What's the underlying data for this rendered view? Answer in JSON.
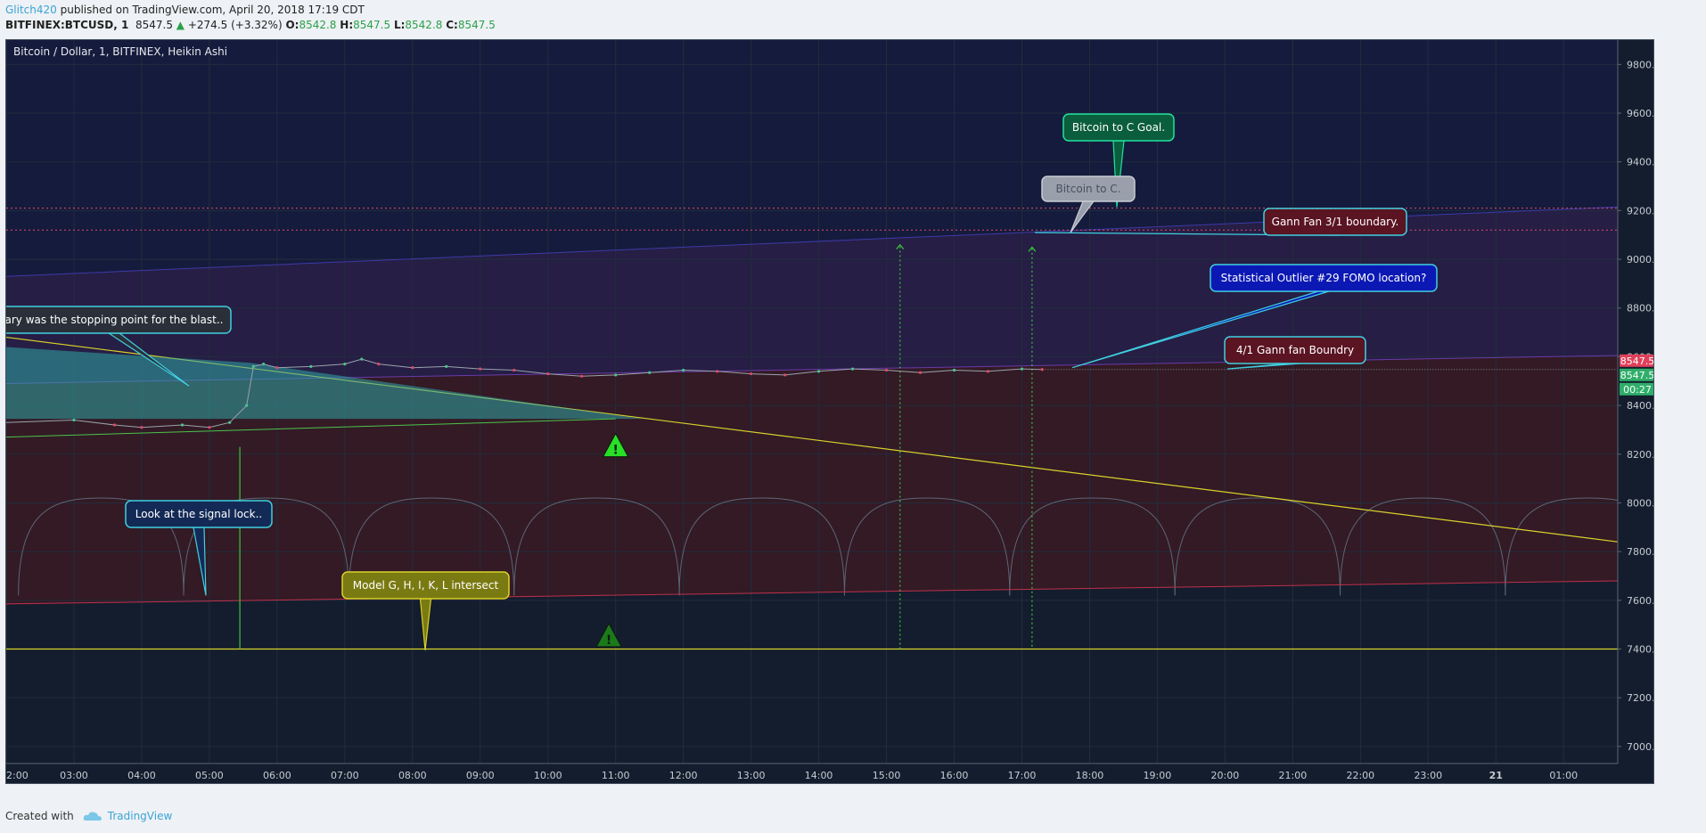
{
  "header": {
    "author": "Glitch420",
    "published": "published on TradingView.com, April 20, 2018 17:19 CDT",
    "symbol": "BITFINEX:BTCUSD, 1",
    "last": "8547.5",
    "change": "+274.5 (+3.32%)",
    "o_label": "O:",
    "o": "8542.8",
    "h_label": "H:",
    "h": "8547.5",
    "l_label": "L:",
    "l": "8542.8",
    "c_label": "C:",
    "c": "8547.5"
  },
  "footer": {
    "created_with": "Created with",
    "brand": "TradingView"
  },
  "colors": {
    "bg": "#131d2d",
    "grid": "#222d3d",
    "bull": "#4bc48a",
    "bear": "#e04b6a",
    "yellow": "#d9d12a",
    "cyan": "#3fd0e0"
  },
  "chart_data": {
    "type": "candlestick",
    "title": "Bitcoin / Dollar, 1, BITFINEX, Heikin Ashi",
    "ylim": [
      6930,
      9900
    ],
    "y_ticks": [
      7000,
      7200,
      7400,
      7600,
      7800,
      8000,
      8200,
      8400,
      8600,
      8800,
      9000,
      9200,
      9400,
      9600,
      9800
    ],
    "y_tick_labels": [
      "7000.0",
      "7200.0",
      "7400.0",
      "7600.0",
      "7800.0",
      "8000.0",
      "8200.0",
      "8400.0",
      "8600.0",
      "8800.0",
      "9000.0",
      "9200.0",
      "9400.0",
      "9600.0",
      "9800.0"
    ],
    "x_labels": [
      "2:00",
      "03:00",
      "04:00",
      "05:00",
      "06:00",
      "07:00",
      "08:00",
      "09:00",
      "10:00",
      "11:00",
      "12:00",
      "13:00",
      "14:00",
      "15:00",
      "16:00",
      "17:00",
      "18:00",
      "19:00",
      "20:00",
      "21:00",
      "22:00",
      "23:00",
      "21",
      "01:00"
    ],
    "x_positions_hours": [
      2,
      3,
      4,
      5,
      6,
      7,
      8,
      9,
      10,
      11,
      12,
      13,
      14,
      15,
      16,
      17,
      18,
      19,
      20,
      21,
      22,
      23,
      24,
      25
    ],
    "x_range_hours": [
      2,
      25.8
    ],
    "price_path": [
      [
        2,
        8330
      ],
      [
        3,
        8340
      ],
      [
        3.6,
        8320
      ],
      [
        4,
        8310
      ],
      [
        4.6,
        8320
      ],
      [
        5,
        8310
      ],
      [
        5.3,
        8330
      ],
      [
        5.55,
        8400
      ],
      [
        5.65,
        8560
      ],
      [
        5.8,
        8570
      ],
      [
        6,
        8555
      ],
      [
        6.5,
        8560
      ],
      [
        7,
        8570
      ],
      [
        7.25,
        8590
      ],
      [
        7.5,
        8570
      ],
      [
        8,
        8555
      ],
      [
        8.5,
        8560
      ],
      [
        9,
        8550
      ],
      [
        9.5,
        8545
      ],
      [
        10,
        8530
      ],
      [
        10.5,
        8520
      ],
      [
        11,
        8525
      ],
      [
        11.5,
        8535
      ],
      [
        12,
        8545
      ],
      [
        12.5,
        8540
      ],
      [
        13,
        8530
      ],
      [
        13.5,
        8525
      ],
      [
        14,
        8540
      ],
      [
        14.5,
        8550
      ],
      [
        15,
        8545
      ],
      [
        15.5,
        8535
      ],
      [
        16,
        8545
      ],
      [
        16.5,
        8540
      ],
      [
        17,
        8550
      ],
      [
        17.3,
        8547.5
      ]
    ],
    "last_price": 8547.5,
    "last_price_label": "8547.5",
    "price_labels": [
      "8547.5",
      "8547.5"
    ],
    "countdown": "00:27",
    "h_lines": [
      {
        "value": 9210,
        "color": "#e04b6a",
        "style": "dotted"
      },
      {
        "value": 9120,
        "color": "#e04b6a",
        "style": "dotted"
      },
      {
        "value": 7400,
        "color": "#d9d12a",
        "style": "solid"
      }
    ],
    "annotations": [
      {
        "text": "Bitcoin to C Goal.",
        "kind": "green"
      },
      {
        "text": "Bitcoin to C.",
        "kind": "gray"
      },
      {
        "text": "Gann Fan 3/1 boundary.",
        "kind": "red"
      },
      {
        "text": "Statistical Outlier #29 FOMO location?",
        "kind": "blue"
      },
      {
        "text": "4/1 Gann fan Boundry",
        "kind": "red"
      },
      {
        "text": "ary was the stopping point for the blast..",
        "kind": "dark"
      },
      {
        "text": "Look at the signal lock..",
        "kind": "blue"
      },
      {
        "text": "Model G, H, I, K, L intersect",
        "kind": "olive"
      }
    ]
  }
}
